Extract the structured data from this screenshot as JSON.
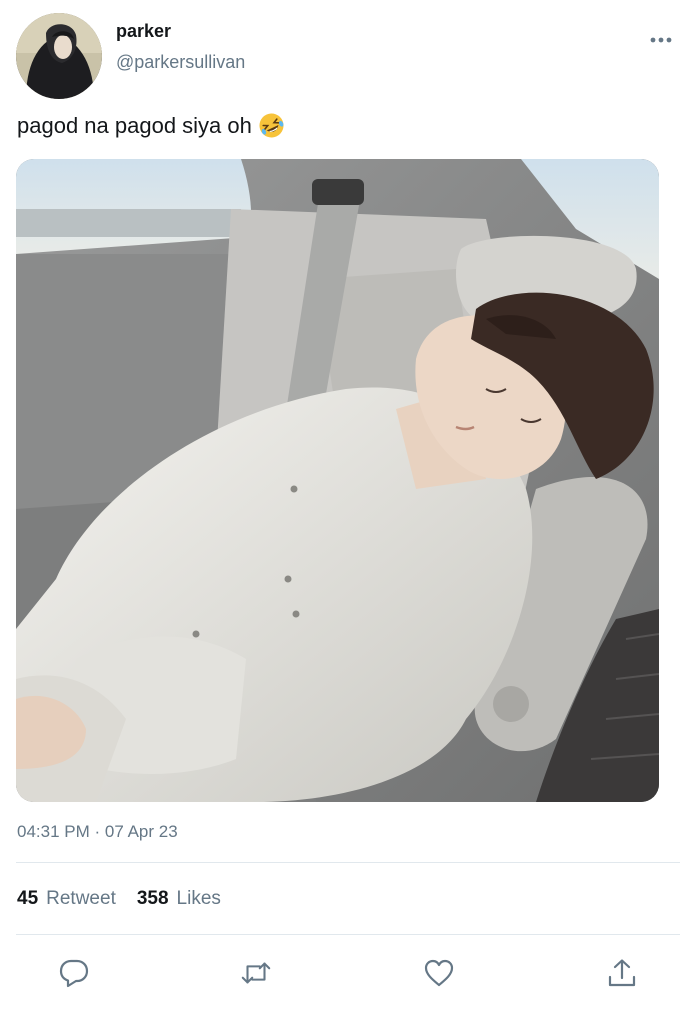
{
  "user": {
    "display_name": "parker",
    "handle": "@parkersullivan"
  },
  "tweet": {
    "text": "pagod na pagod siya oh",
    "emoji": "rolling-on-floor-laughing"
  },
  "timestamp": "04:31 PM · 07 Apr 23",
  "stats": {
    "retweet_count": "45",
    "retweet_label": "Retweet",
    "likes_count": "358",
    "likes_label": "Likes"
  },
  "actions": [
    "reply-icon",
    "retweet-icon",
    "like-icon",
    "share-icon"
  ],
  "colors": {
    "text_primary": "#14171a",
    "text_secondary": "#657786",
    "divider": "#e1e8ed"
  }
}
